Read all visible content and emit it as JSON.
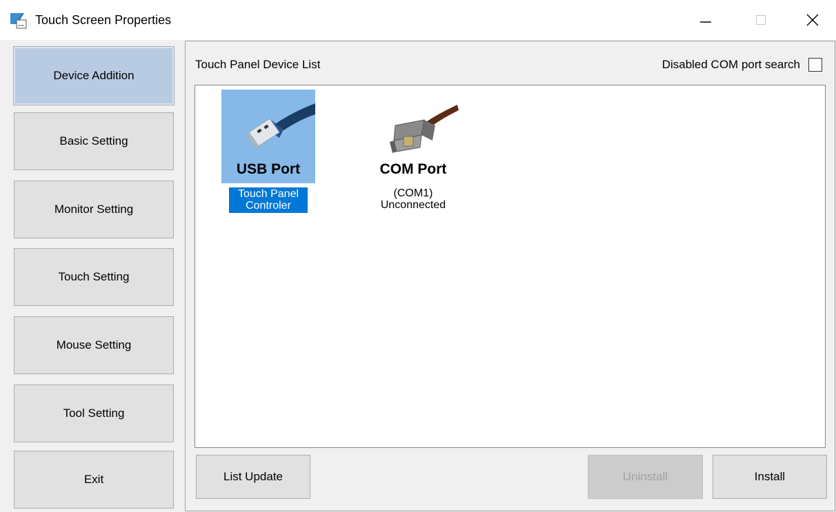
{
  "window": {
    "title": "Touch Screen Properties",
    "minimize_symbol": "—",
    "maximize_symbol": "□",
    "close_symbol": "✕"
  },
  "sidebar": {
    "items": [
      {
        "label": "Device Addition",
        "active": true
      },
      {
        "label": "Basic Setting",
        "active": false
      },
      {
        "label": "Monitor Setting",
        "active": false
      },
      {
        "label": "Touch Setting",
        "active": false
      },
      {
        "label": "Mouse Setting",
        "active": false
      },
      {
        "label": "Tool Setting",
        "active": false
      },
      {
        "label": "Exit",
        "active": false
      }
    ]
  },
  "main": {
    "list_title": "Touch Panel Device List",
    "com_search_label": "Disabled COM port search",
    "com_search_checked": false,
    "devices": {
      "usb": {
        "name": "USB Port",
        "line1": "Touch Panel",
        "line2": "Controler",
        "selected": true,
        "icon": "usb-plug-icon"
      },
      "com": {
        "name": "COM Port",
        "line1": "(COM1)",
        "line2": "Unconnected",
        "selected": false,
        "icon": "serial-connector-icon"
      }
    },
    "buttons": {
      "list_update": "List Update",
      "uninstall": "Uninstall",
      "install": "Install"
    }
  },
  "colors": {
    "selection_bg": "#86b9e8",
    "selection_text_bg": "#0078d7",
    "active_sidebar": "#b9cbe3",
    "window_bg": "#f0f0f0"
  }
}
